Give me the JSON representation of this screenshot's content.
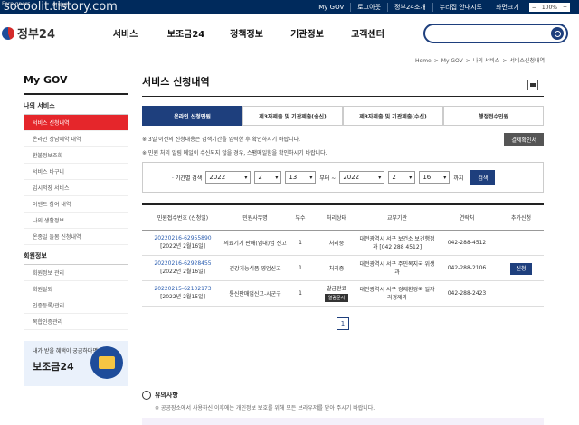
{
  "watermark": "socoolit.tistory.com",
  "topbar": {
    "lang1": "Foreigners",
    "lang2": "어학뱅",
    "links": [
      "My GOV",
      "로그아웃",
      "정부24소개",
      "누리집 안내지도",
      "화면크기"
    ],
    "zoom": "100%",
    "zoom_minus": "−",
    "zoom_plus": "+"
  },
  "header": {
    "logo": "정부24",
    "nav": [
      "서비스",
      "보조금24",
      "정책정보",
      "기관정보",
      "고객센터"
    ]
  },
  "breadcrumb": [
    "Home",
    ">",
    "My GOV",
    ">",
    "나의 서비스",
    ">",
    "서비스신청내역"
  ],
  "sidebar": {
    "title": "My GOV",
    "section1": "나의 서비스",
    "items1": [
      "서비스 신청내역",
      "온라인 상담예약 내역",
      "환불정보조회",
      "서비스 바구니",
      "임시저장 서비스",
      "이벤트 참여 내역",
      "나의 생활정보",
      "온종일 돌봄 신청내역"
    ],
    "section2": "회원정보",
    "items2": [
      "회원정보 관리",
      "회원탈퇴",
      "인증등록/관리",
      "복합인증관리"
    ],
    "banner_l1": "내가 받을 혜택이 궁금하다면?",
    "banner_l2": "보조금24"
  },
  "main": {
    "title": "서비스 신청내역",
    "tabs": [
      "온라인 신청민원",
      "제3자제출 및 기관제출(송신)",
      "제3자제출 및 기관제출(수신)",
      "행정접수민원"
    ],
    "note1": "※ 3일 이전의 신청내용은 검색기간을 입력한 후 확인하시기 바랍니다.",
    "note2": "※ 민원 처리 알림 메일이 수신되지 않을 경우, 스팸메일함을 확인하시기 바랍니다.",
    "receipt_btn": "결제확인서",
    "filter": {
      "label": "· 기간별 검색",
      "y1": "2022",
      "m1": "2",
      "d1": "13",
      "from": "부터 ~",
      "y2": "2022",
      "m2": "2",
      "d2": "16",
      "to": "까지",
      "search": "검색"
    },
    "columns": [
      "민원접수번호 (신청일)",
      "민원사무명",
      "부수",
      "처리상태",
      "교부기관",
      "연락처",
      "추가신청"
    ],
    "rows": [
      {
        "no": "20220216-62955890",
        "date": "[2022년 2월16일]",
        "name": "의료기기 판매(임대)업 신고",
        "count": "1",
        "status": "처리중",
        "agency": "대전광역시 서구 보건소 보건행정과 [042 288 4512]",
        "phone": "042-288-4512",
        "extra": ""
      },
      {
        "no": "20220216-62928455",
        "date": "[2022년 2월16일]",
        "name": "건강기능식품 영업신고",
        "count": "1",
        "status": "처리중",
        "agency": "대전광역시 서구 주민복지국 위생과",
        "phone": "042-288-2106",
        "extra": "신청"
      },
      {
        "no": "20220215-62102173",
        "date": "[2022년 2월15일]",
        "name": "통신판매업신고-시군구",
        "count": "1",
        "status": "발급완료",
        "badge": "열람문서",
        "agency": "대전광역시 서구 경제환경국 일자리경제과",
        "phone": "042-288-2423",
        "extra": ""
      }
    ],
    "page": "1"
  },
  "caution": {
    "title": "유의사항",
    "desc": "※ 공공장소에서 사용하신 이후에는 개인정보 보호를 위해 모든 브라우저를 닫아 주시기 바랍니다."
  }
}
